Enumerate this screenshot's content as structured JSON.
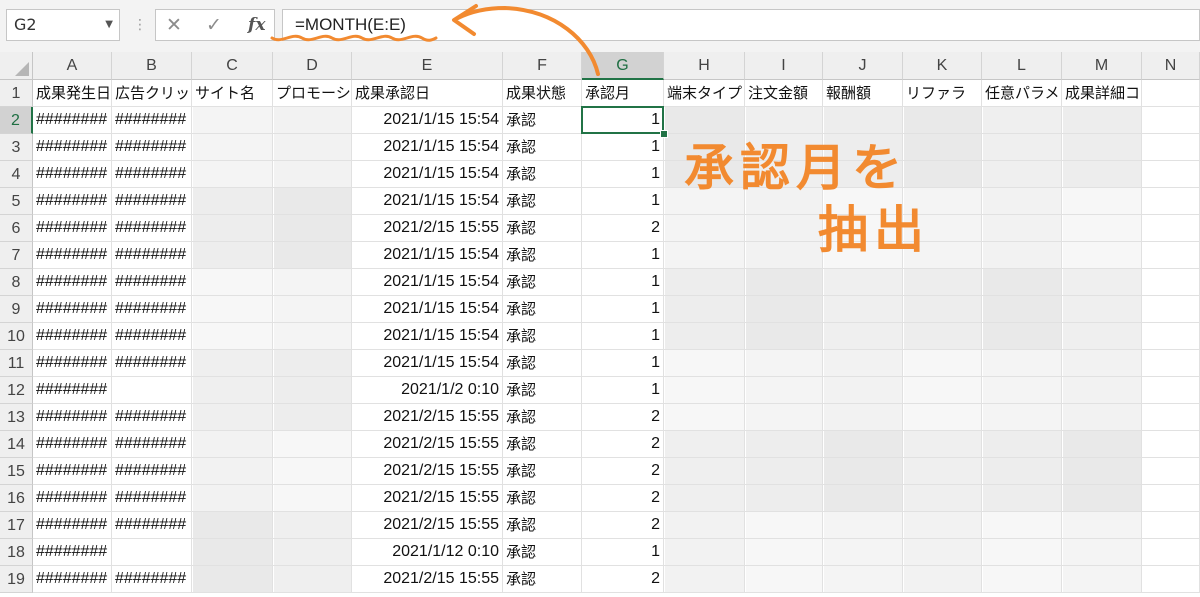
{
  "formula_bar": {
    "name_box": "G2",
    "cancel_icon": "✕",
    "enter_icon": "✓",
    "fx_label": "fx",
    "formula": "=MONTH(E:E)"
  },
  "columns": [
    "A",
    "B",
    "C",
    "D",
    "E",
    "F",
    "G",
    "H",
    "I",
    "J",
    "K",
    "L",
    "M",
    "N"
  ],
  "headers": [
    "成果発生日",
    "広告クリック",
    "サイト名",
    "プロモーション",
    "成果承認日",
    "成果状態",
    "承認月",
    "端末タイプ",
    "注文金額",
    "報酬額",
    "リファラ",
    "任意パラメータ",
    "成果詳細コード",
    ""
  ],
  "rows": [
    {
      "a": "########",
      "b": "########",
      "e": "2021/1/15 15:54",
      "f": "承認",
      "g": "1"
    },
    {
      "a": "########",
      "b": "########",
      "e": "2021/1/15 15:54",
      "f": "承認",
      "g": "1"
    },
    {
      "a": "########",
      "b": "########",
      "e": "2021/1/15 15:54",
      "f": "承認",
      "g": "1"
    },
    {
      "a": "########",
      "b": "########",
      "e": "2021/1/15 15:54",
      "f": "承認",
      "g": "1"
    },
    {
      "a": "########",
      "b": "########",
      "e": "2021/2/15 15:55",
      "f": "承認",
      "g": "2"
    },
    {
      "a": "########",
      "b": "########",
      "e": "2021/1/15 15:54",
      "f": "承認",
      "g": "1"
    },
    {
      "a": "########",
      "b": "########",
      "e": "2021/1/15 15:54",
      "f": "承認",
      "g": "1"
    },
    {
      "a": "########",
      "b": "########",
      "e": "2021/1/15 15:54",
      "f": "承認",
      "g": "1"
    },
    {
      "a": "########",
      "b": "########",
      "e": "2021/1/15 15:54",
      "f": "承認",
      "g": "1"
    },
    {
      "a": "########",
      "b": "########",
      "e": "2021/1/15 15:54",
      "f": "承認",
      "g": "1"
    },
    {
      "a": "########",
      "b": "",
      "e": "2021/1/2 0:10",
      "f": "承認",
      "g": "1"
    },
    {
      "a": "########",
      "b": "########",
      "e": "2021/2/15 15:55",
      "f": "承認",
      "g": "2"
    },
    {
      "a": "########",
      "b": "########",
      "e": "2021/2/15 15:55",
      "f": "承認",
      "g": "2"
    },
    {
      "a": "########",
      "b": "########",
      "e": "2021/2/15 15:55",
      "f": "承認",
      "g": "2"
    },
    {
      "a": "########",
      "b": "########",
      "e": "2021/2/15 15:55",
      "f": "承認",
      "g": "2"
    },
    {
      "a": "########",
      "b": "########",
      "e": "2021/2/15 15:55",
      "f": "承認",
      "g": "2"
    },
    {
      "a": "########",
      "b": "",
      "e": "2021/1/12 0:10",
      "f": "承認",
      "g": "1"
    },
    {
      "a": "########",
      "b": "########",
      "e": "2021/2/15 15:55",
      "f": "承認",
      "g": "2"
    }
  ],
  "annotation": {
    "line1": "承認月を",
    "line2": "抽出"
  },
  "colors": {
    "accent": "#217346",
    "annotation": "#f28a30"
  }
}
